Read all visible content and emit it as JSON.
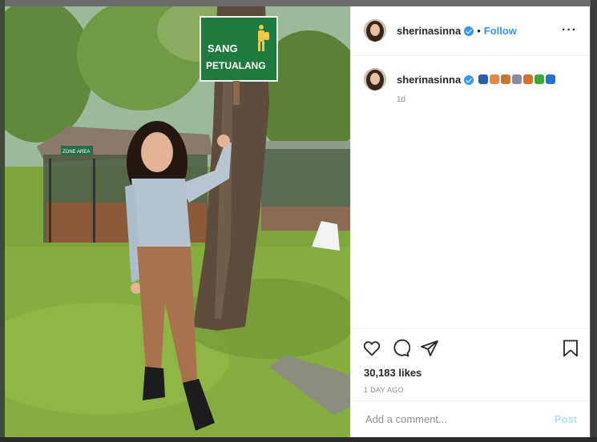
{
  "post": {
    "username": "sherinasinna",
    "separator": "•",
    "follow_label": "Follow",
    "more_label": "···"
  },
  "caption": {
    "username": "sherinasinna",
    "emoji_icons": [
      "mask-icon",
      "bandage-icon",
      "bread-icon",
      "gift-icon",
      "butterfly-icon",
      "pill-icon",
      "hiking-boot-icon"
    ],
    "emoji_colors": [
      "#2a5fa8",
      "#e2884a",
      "#c8763a",
      "#8a8a9a",
      "#d0722a",
      "#3aa83a",
      "#2a70c8"
    ],
    "time_ago": "1d"
  },
  "photo": {
    "sign_line1": "SANG",
    "sign_line2": "PETUALANG",
    "small_sign": "ZONE AREA"
  },
  "engagement": {
    "likes": "30,183 likes",
    "posted": "1 DAY AGO"
  },
  "comment": {
    "placeholder": "Add a comment...",
    "post_label": "Post"
  },
  "colors": {
    "accent": "#3897f0",
    "post_disabled": "#b2dffc"
  }
}
